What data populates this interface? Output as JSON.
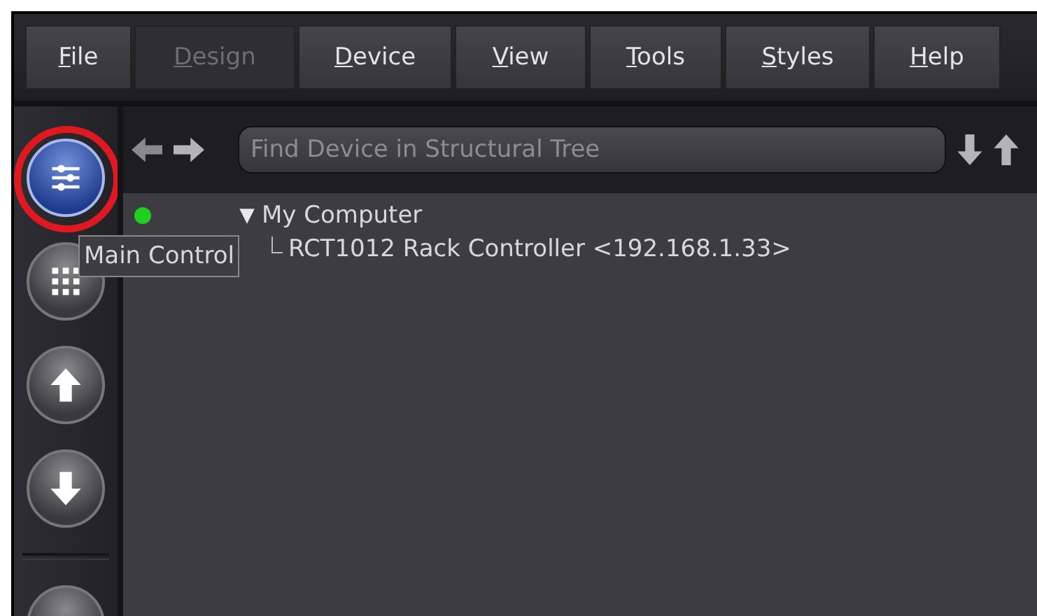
{
  "menu": [
    {
      "label": "File",
      "disabled": false
    },
    {
      "label": "Design",
      "disabled": true
    },
    {
      "label": "Device",
      "disabled": false
    },
    {
      "label": "View",
      "disabled": false
    },
    {
      "label": "Tools",
      "disabled": false
    },
    {
      "label": "Styles",
      "disabled": false
    },
    {
      "label": "Help",
      "disabled": false
    }
  ],
  "sidebar": {
    "buttons": [
      {
        "kind": "sliders",
        "highlighted": true
      },
      {
        "kind": "grid",
        "highlighted": false
      },
      {
        "kind": "up",
        "highlighted": false
      },
      {
        "kind": "down",
        "highlighted": false
      },
      {
        "kind": "separator"
      },
      {
        "kind": "plain",
        "highlighted": false
      }
    ]
  },
  "tooltip": {
    "text": "Main Control"
  },
  "search": {
    "placeholder": "Find Device in Structural Tree"
  },
  "tree": [
    {
      "label": "My Computer",
      "expanded": true,
      "online": true,
      "children": [
        {
          "label": "RCT1012 Rack Controller <192.168.1.33>"
        }
      ]
    }
  ]
}
